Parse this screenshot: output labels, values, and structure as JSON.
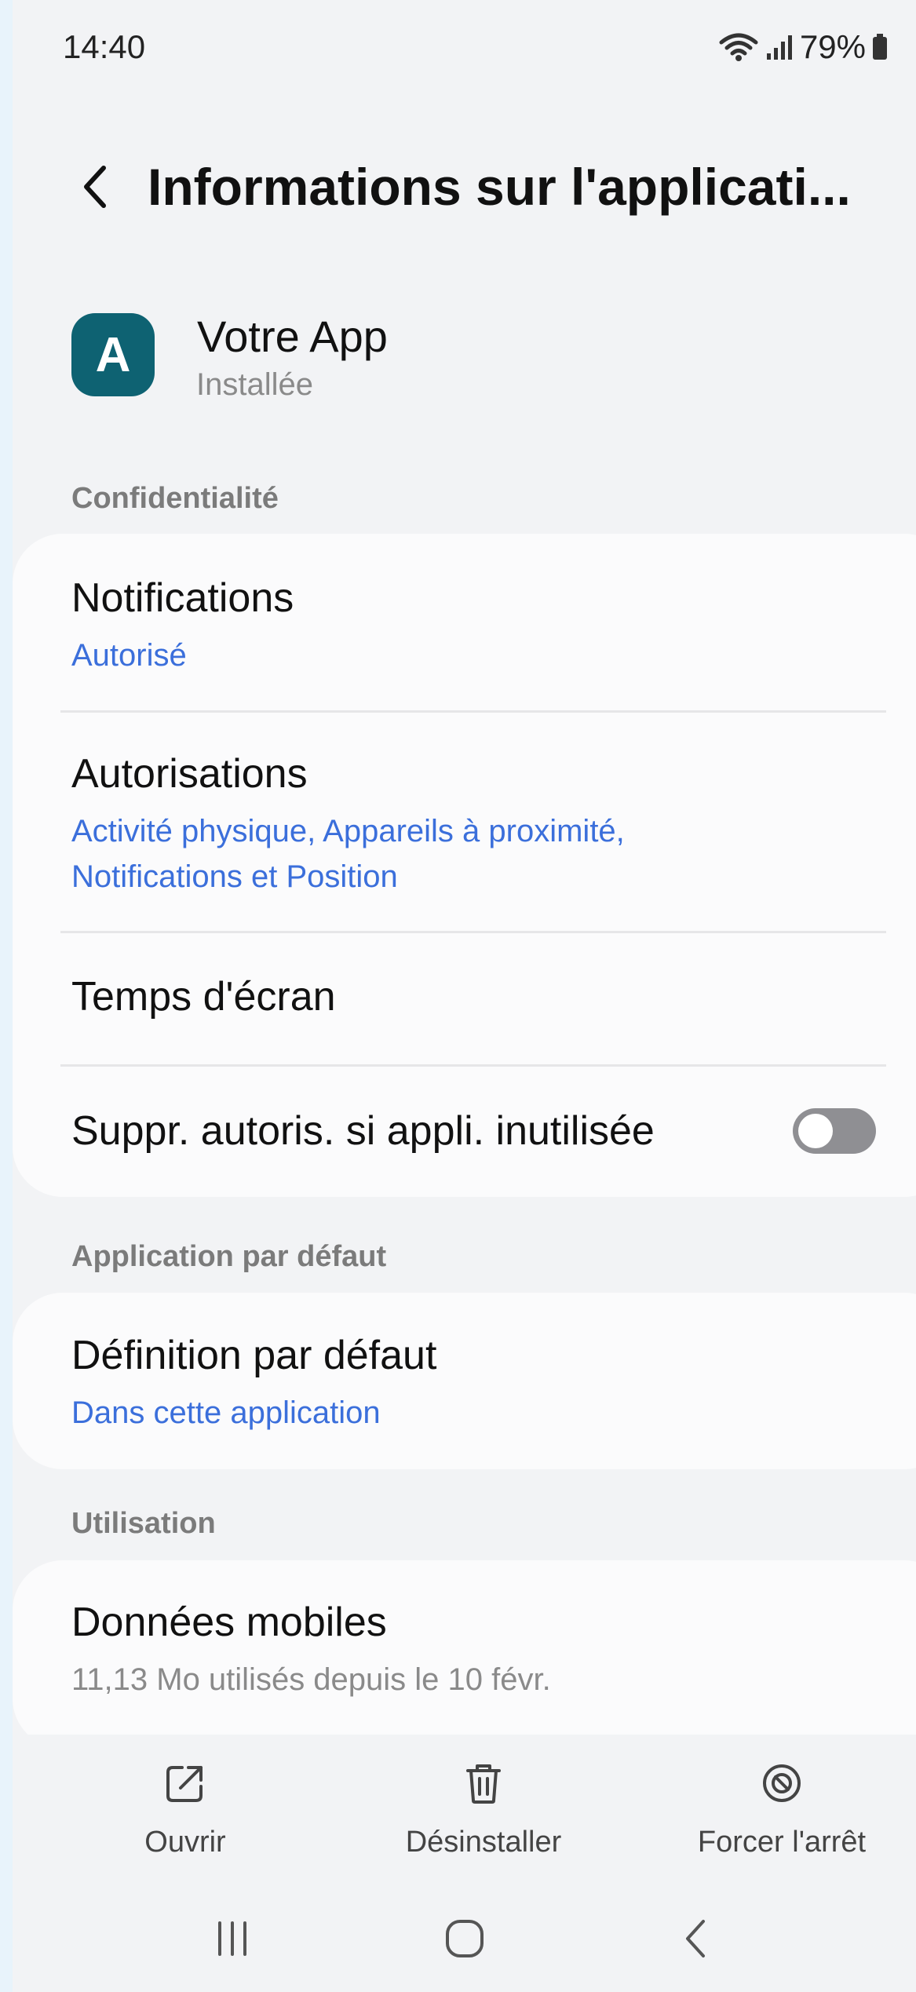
{
  "status_bar": {
    "time": "14:40",
    "battery": "79%",
    "icons": [
      "wifi-icon",
      "signal-icon",
      "battery-icon"
    ]
  },
  "header": {
    "back_icon": "back-chevron-icon",
    "title": "Informations sur l'applicati..."
  },
  "app": {
    "icon_letter": "A",
    "icon_color": "#0e6272",
    "name": "Votre App",
    "status": "Installée"
  },
  "sections": {
    "privacy": {
      "label": "Confidentialité",
      "notifications": {
        "title": "Notifications",
        "subtitle": "Autorisé"
      },
      "permissions": {
        "title": "Autorisations",
        "subtitle_line1": "Activité physique, Appareils à proximité,",
        "subtitle_line2": "Notifications et Position"
      },
      "screen_time": {
        "title": "Temps d'écran"
      },
      "remove_permissions": {
        "title": "Suppr. autoris. si appli. inutilisée",
        "enabled": false
      }
    },
    "default_app": {
      "label": "Application par défaut",
      "set_default": {
        "title": "Définition par défaut",
        "subtitle": "Dans cette application"
      }
    },
    "usage": {
      "label": "Utilisation",
      "mobile_data": {
        "title": "Données mobiles",
        "subtitle": "11,13 Mo utilisés depuis le 10 févr."
      }
    }
  },
  "actions": {
    "open": {
      "label": "Ouvrir",
      "icon": "open-external-icon"
    },
    "uninstall": {
      "label": "Désinstaller",
      "icon": "trash-icon"
    },
    "force_stop": {
      "label": "Forcer l'arrêt",
      "icon": "stop-icon"
    }
  },
  "navigation": {
    "recents_icon": "recents-icon",
    "home_icon": "home-icon",
    "back_icon": "nav-back-icon"
  },
  "colors": {
    "accent": "#3b6fdb",
    "background": "#f2f3f5",
    "card": "#fbfbfc"
  }
}
